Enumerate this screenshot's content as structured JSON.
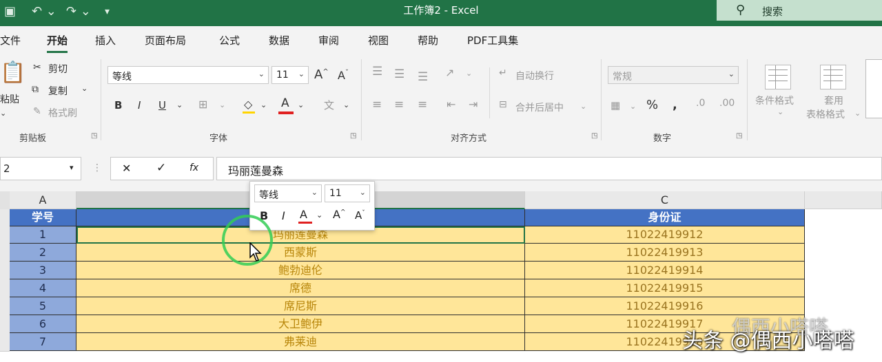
{
  "window": {
    "title": "工作簿2 - Excel"
  },
  "search": {
    "label": "搜索"
  },
  "tabs": [
    "文件",
    "开始",
    "插入",
    "页面布局",
    "公式",
    "数据",
    "审阅",
    "视图",
    "帮助",
    "PDF工具集"
  ],
  "ribbon": {
    "clipboard": {
      "paste": "粘贴",
      "cut": "剪切",
      "copy": "复制",
      "format_painter": "格式刷",
      "group": "剪贴板"
    },
    "font": {
      "name": "等线",
      "size": "11",
      "bold": "B",
      "italic": "I",
      "underline": "U",
      "grow": "A",
      "shrink": "A",
      "color_letter": "A",
      "group": "字体"
    },
    "alignment": {
      "wrap": "自动换行",
      "merge": "合并后居中",
      "group": "对齐方式"
    },
    "number": {
      "format": "常规",
      "group": "数字"
    },
    "styles": {
      "conditional": "条件格式",
      "table": "套用",
      "table2": "表格格式"
    }
  },
  "formula_bar": {
    "name_box": "2",
    "cancel": "✕",
    "enter": "✓",
    "fx": "fx",
    "content": "玛丽莲曼森"
  },
  "mini_toolbar": {
    "font": "等线",
    "size": "11",
    "bold": "B",
    "italic": "I",
    "color": "A",
    "grow": "A",
    "shrink": "A"
  },
  "columns": [
    "A",
    "",
    "C"
  ],
  "headers": {
    "a": "学号",
    "b": "",
    "c": "身份证"
  },
  "rows": [
    {
      "id": "1",
      "name": "玛丽莲曼森",
      "idcard": "11022419912"
    },
    {
      "id": "2",
      "name": "西蒙斯",
      "idcard": "11022419913"
    },
    {
      "id": "3",
      "name": "鲍勃迪伦",
      "idcard": "11022419914"
    },
    {
      "id": "4",
      "name": "席德",
      "idcard": "11022419915"
    },
    {
      "id": "5",
      "name": "席尼斯",
      "idcard": "11022419916"
    },
    {
      "id": "6",
      "name": "大卫鲍伊",
      "idcard": "11022419917"
    },
    {
      "id": "7",
      "name": "弗莱迪",
      "idcard": "11022419918"
    }
  ],
  "watermark": {
    "text": "头条 @偶西小嗒嗒",
    "faint": "偶西小嗒嗒"
  },
  "colors": {
    "title_bar": "#217346",
    "header_fill": "#4472c4",
    "number_fill": "#8ea9db",
    "name_fill": "#ffe699"
  }
}
